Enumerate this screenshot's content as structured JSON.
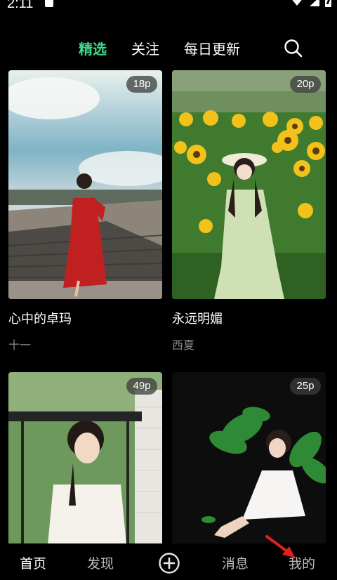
{
  "status_bar": {
    "time": "2:11"
  },
  "top_tabs": [
    {
      "label": "精选",
      "active": true
    },
    {
      "label": "关注",
      "active": false
    },
    {
      "label": "每日更新",
      "active": false
    }
  ],
  "search": {
    "icon": "search-icon"
  },
  "cards": [
    {
      "title": "心中的卓玛",
      "author": "十一",
      "count": "18p"
    },
    {
      "title": "永远明媚",
      "author": "西夏",
      "count": "20p"
    },
    {
      "title": "",
      "author": "",
      "count": "49p"
    },
    {
      "title": "",
      "author": "",
      "count": "25p"
    }
  ],
  "bottom_nav": {
    "home": "首页",
    "discover": "发现",
    "add_icon": "plus-circle-icon",
    "messages": "消息",
    "mine": "我的"
  },
  "colors": {
    "accent": "#3fd98a",
    "background": "#000000",
    "annotation_arrow": "#e02020"
  }
}
